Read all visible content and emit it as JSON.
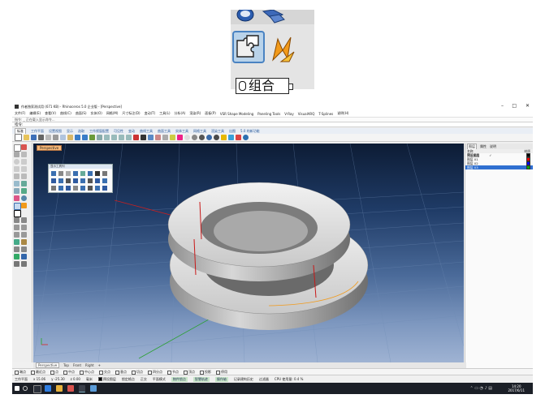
{
  "inset": {
    "tooltip_text": "组合"
  },
  "app": {
    "title": "作者独家测试用 (671 KB) - Rhinoceros 5.0 企业版 - [Perspective]",
    "window_controls": {
      "minimize": "–",
      "maximize": "□",
      "close": "✕"
    },
    "menu": [
      "文件(F)",
      "编辑(E)",
      "查看(V)",
      "曲线(C)",
      "曲面(S)",
      "实体(O)",
      "网格(M)",
      "尺寸标注(D)",
      "变动(T)",
      "工具(L)",
      "分析(A)",
      "渲染(R)",
      "面板(P)",
      "VSR Shape Modeling",
      "Paneling Tools",
      "V-Ray",
      "VisualARQ",
      "T-Splines",
      "说明(H)"
    ],
    "command_history": "指令: _ 正在载入显示命令...",
    "command_prompt": "指令:",
    "tabs": [
      "标准",
      "工作平面",
      "设置视图",
      "显示",
      "选取",
      "工作视窗配置",
      "可见性",
      "变动",
      "曲线工具",
      "曲面工具",
      "实体工具",
      "网格工具",
      "渲染工具",
      "出图",
      "5.0 的新功能"
    ],
    "active_tab_index": 0,
    "viewport_label": "Perspective",
    "float_panel_title": "显示工具列",
    "viewport_tabs": [
      "Perspective",
      "Top",
      "Front",
      "Right",
      "+"
    ],
    "osnap": [
      "端点",
      "最近点",
      "点",
      "中点",
      "中心点",
      "交点",
      "垂点",
      "切点",
      "四分点",
      "节点",
      "顶点",
      "投影",
      "停用"
    ],
    "status": {
      "plane": "工作平面",
      "x": "x 15.06",
      "y": "y -25.30",
      "z": "z 0.00",
      "unit": "毫米",
      "layer": "预设图层",
      "items": [
        "锁定格点",
        "正交",
        "平面模式",
        "物件锁点",
        "智慧轨迹",
        "操作轴",
        "记录建构历史",
        "过滤器",
        "CPU 使用量: 0.4 %"
      ]
    },
    "right_panel": {
      "tabs": [
        "图层",
        "属性",
        "说明"
      ],
      "header": [
        "名称",
        "",
        "材质"
      ],
      "layers": [
        {
          "name": "预设图层",
          "color": "#000000",
          "current": true
        },
        {
          "name": "图层 01",
          "color": "#ff0000",
          "current": false
        },
        {
          "name": "图层 02",
          "color": "#0000ff",
          "current": false
        },
        {
          "name": "图层 03",
          "color": "#00a000",
          "current": false
        }
      ]
    },
    "taskbar": {
      "time": "14:20",
      "date": "2017/6/11"
    }
  }
}
